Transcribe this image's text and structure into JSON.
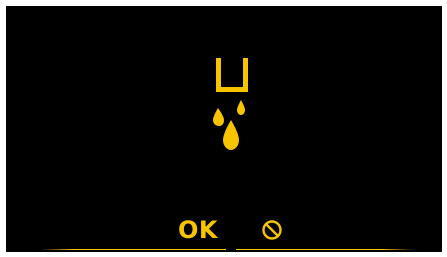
{
  "screen": {
    "background": "#000000",
    "accent": "#f7c400",
    "status_icon": "water-dripping-container-icon"
  },
  "actions": {
    "ok_label": "OK",
    "cancel_icon": "prohibited-icon"
  }
}
